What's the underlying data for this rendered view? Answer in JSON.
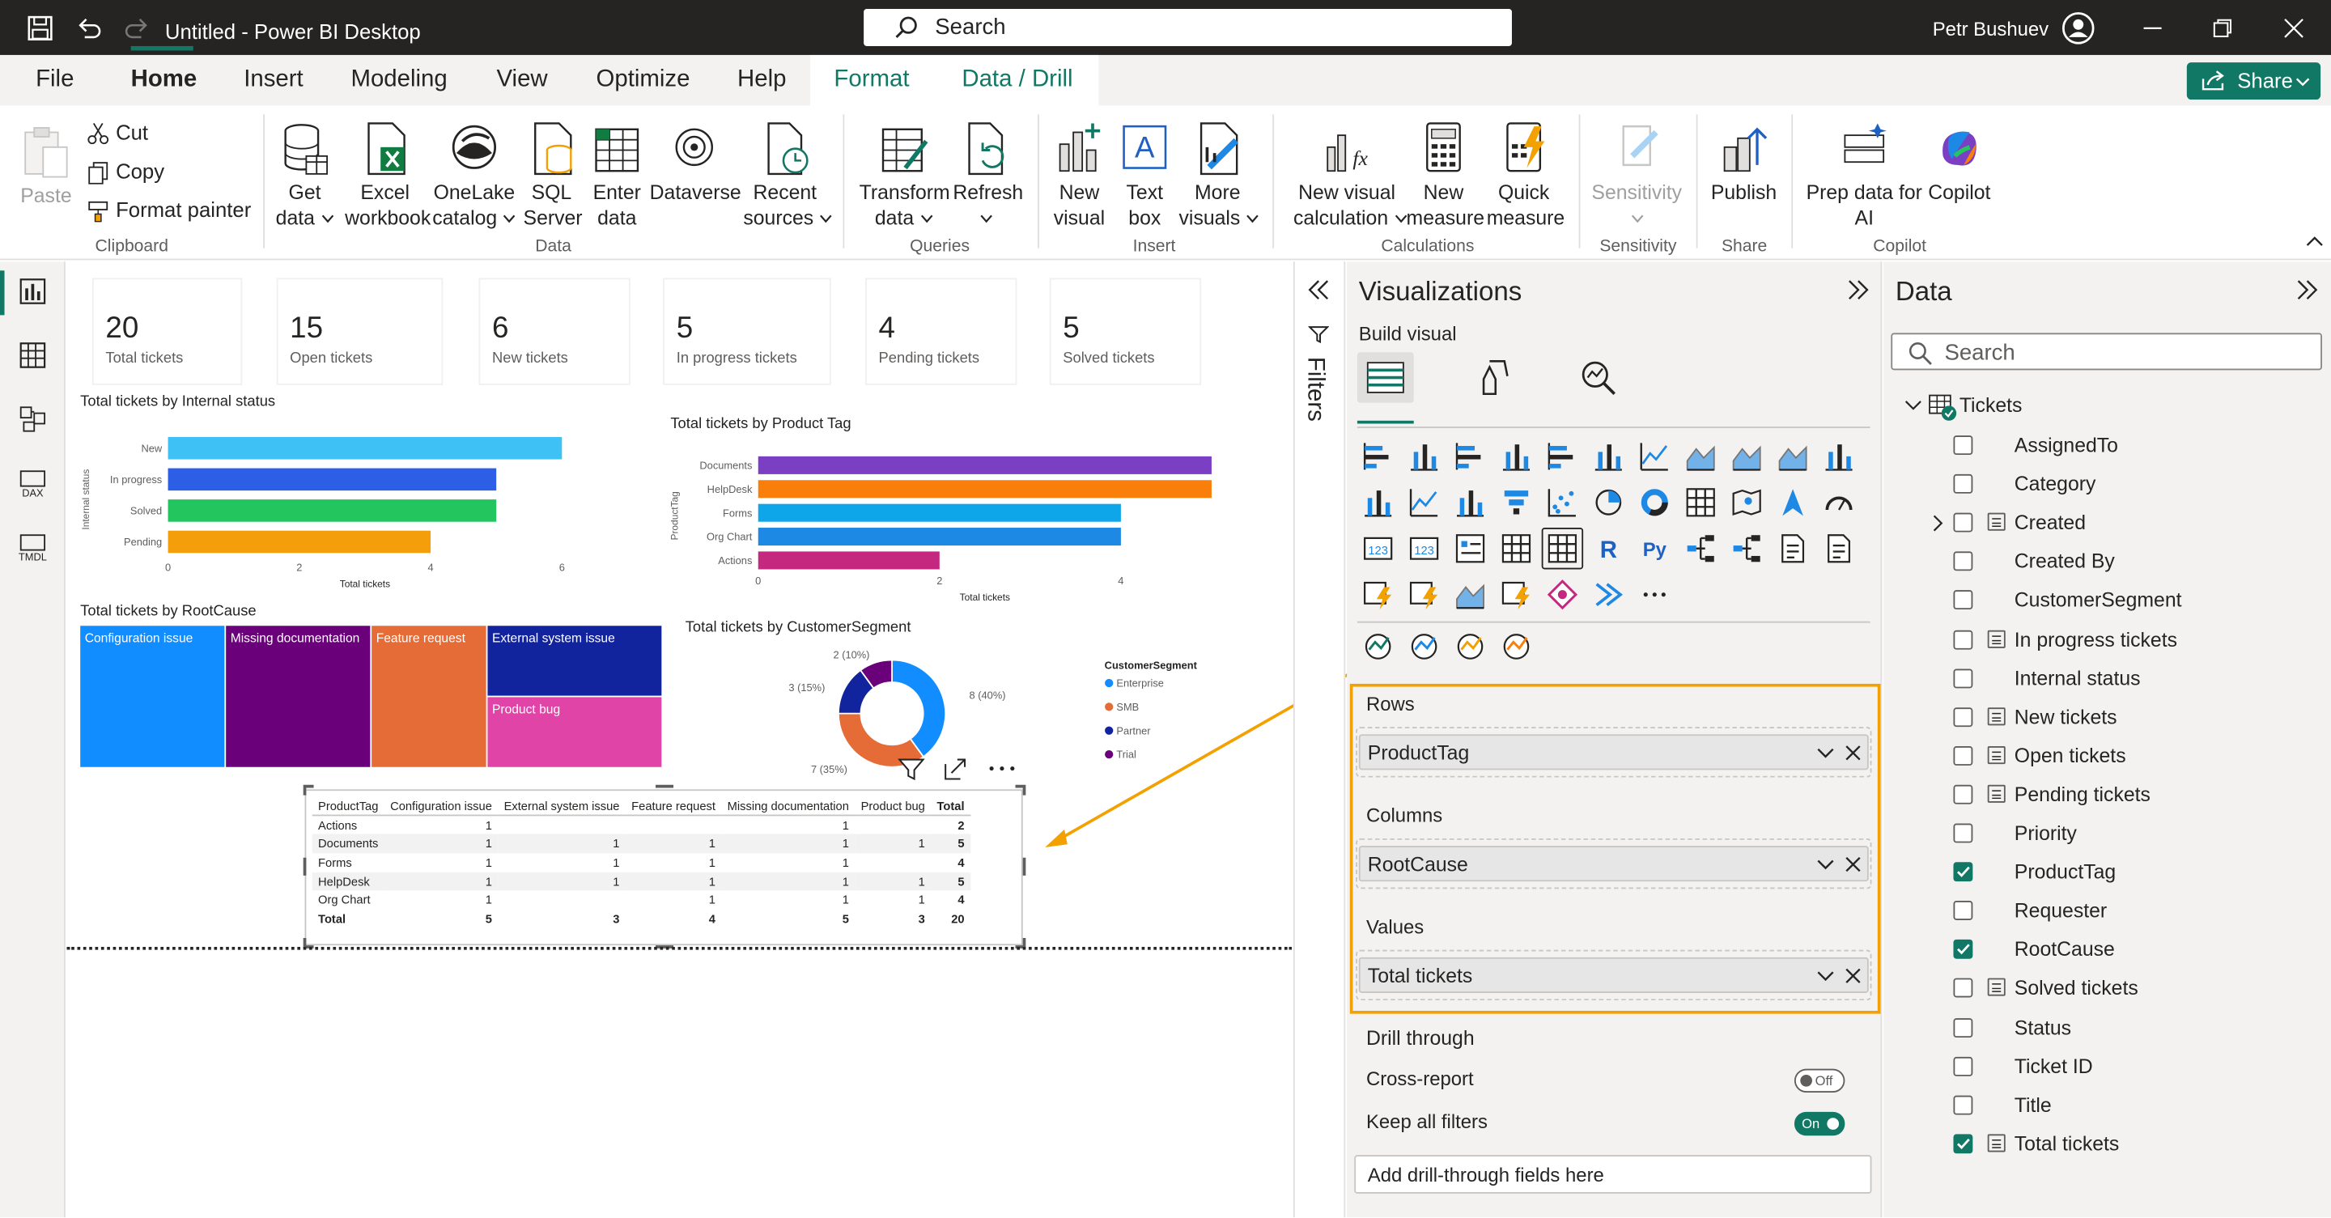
{
  "window": {
    "title": "Untitled - Power BI Desktop",
    "search": "Search",
    "user": "Petr Bushuev"
  },
  "menu": {
    "items": [
      "File",
      "Home",
      "Insert",
      "Modeling",
      "View",
      "Optimize",
      "Help",
      "Format",
      "Data / Drill"
    ],
    "share": "Share"
  },
  "ribbon": {
    "clipboard": {
      "paste": "Paste",
      "cut": "Cut",
      "copy": "Copy",
      "format_painter": "Format painter",
      "group": "Clipboard"
    },
    "data": {
      "get_data": [
        "Get",
        "data"
      ],
      "excel": [
        "Excel",
        "workbook"
      ],
      "onelake": [
        "OneLake",
        "catalog"
      ],
      "sql": [
        "SQL",
        "Server"
      ],
      "enter": [
        "Enter",
        "data"
      ],
      "dataverse": "Dataverse",
      "recent": [
        "Recent",
        "sources"
      ],
      "group": "Data"
    },
    "queries": {
      "transform": [
        "Transform",
        "data"
      ],
      "refresh": "Refresh",
      "group": "Queries"
    },
    "insert": {
      "new_visual": [
        "New",
        "visual"
      ],
      "text_box": [
        "Text",
        "box"
      ],
      "more": [
        "More",
        "visuals"
      ],
      "group": "Insert"
    },
    "calculations": {
      "new_visual_calc": [
        "New visual",
        "calculation"
      ],
      "new_measure": [
        "New",
        "measure"
      ],
      "quick_measure": [
        "Quick",
        "measure"
      ],
      "group": "Calculations"
    },
    "sensitivity": {
      "label": "Sensitivity",
      "group": "Sensitivity"
    },
    "share": {
      "publish": "Publish",
      "group": "Share"
    },
    "copilot": {
      "prep": [
        "Prep data for",
        "AI"
      ],
      "copilot": "Copilot",
      "group": "Copilot"
    }
  },
  "left_nav": {
    "items": [
      "report-view",
      "table-view",
      "model-view",
      "DAX",
      "TMDL"
    ]
  },
  "cards": [
    {
      "value": "20",
      "label": "Total tickets"
    },
    {
      "value": "15",
      "label": "Open tickets"
    },
    {
      "value": "6",
      "label": "New tickets"
    },
    {
      "value": "5",
      "label": "In progress tickets"
    },
    {
      "value": "4",
      "label": "Pending tickets"
    },
    {
      "value": "5",
      "label": "Solved tickets"
    }
  ],
  "chart_data": [
    {
      "type": "bar",
      "title": "Total tickets by Internal status",
      "categories": [
        "New",
        "In progress",
        "Solved",
        "Pending"
      ],
      "values": [
        6,
        5,
        5,
        4
      ],
      "colors": [
        "#3ec2f5",
        "#2d5ee6",
        "#22c55e",
        "#f59e0b"
      ],
      "xlabel": "Total tickets",
      "ylabel": "Internal status",
      "xlim": [
        0,
        6
      ],
      "xticks": [
        "0",
        "2",
        "4",
        "6"
      ]
    },
    {
      "type": "bar",
      "title": "Total tickets by Product Tag",
      "categories": [
        "Documents",
        "HelpDesk",
        "Forms",
        "Org Chart",
        "Actions"
      ],
      "values": [
        5,
        5,
        4,
        4,
        2
      ],
      "colors": [
        "#7b3fc4",
        "#f97f0a",
        "#0ea5e9",
        "#1e88e5",
        "#c4287f"
      ],
      "xlabel": "Total tickets",
      "ylabel": "ProductTag",
      "xlim": [
        0,
        5
      ],
      "xticks": [
        "0",
        "2",
        "4"
      ]
    },
    {
      "type": "heatmap",
      "title": "Total tickets by RootCause",
      "categories": [
        "Configuration issue",
        "Missing documentation",
        "Feature request",
        "External system issue",
        "Product bug"
      ],
      "values": [
        5,
        5,
        4,
        3,
        3
      ],
      "colors": [
        "#118dff",
        "#6b007b",
        "#e66c37",
        "#12239e",
        "#e044a7"
      ]
    },
    {
      "type": "pie",
      "title": "Total tickets by CustomerSegment",
      "legend_title": "CustomerSegment",
      "categories": [
        "Enterprise",
        "SMB",
        "Partner",
        "Trial"
      ],
      "values": [
        8,
        7,
        3,
        2
      ],
      "labels": [
        "8 (40%)",
        "7 (35%)",
        "3 (15%)",
        "2 (10%)"
      ],
      "colors": [
        "#118dff",
        "#e66c37",
        "#12239e",
        "#6b007b"
      ]
    }
  ],
  "matrix": {
    "headers": [
      "ProductTag",
      "Configuration issue",
      "External system issue",
      "Feature request",
      "Missing documentation",
      "Product bug",
      "Total"
    ],
    "rows": [
      [
        "Actions",
        "1",
        "",
        "",
        "1",
        "",
        "2"
      ],
      [
        "Documents",
        "1",
        "1",
        "1",
        "1",
        "1",
        "5"
      ],
      [
        "Forms",
        "1",
        "1",
        "1",
        "1",
        "",
        "4"
      ],
      [
        "HelpDesk",
        "1",
        "1",
        "1",
        "1",
        "1",
        "5"
      ],
      [
        "Org Chart",
        "1",
        "",
        "1",
        "1",
        "1",
        "4"
      ],
      [
        "Total",
        "5",
        "3",
        "4",
        "5",
        "3",
        "20"
      ]
    ]
  },
  "filters": {
    "label": "Filters"
  },
  "visualizations": {
    "title": "Visualizations",
    "build": "Build visual",
    "wells": {
      "rows": "Rows",
      "rows_field": "ProductTag",
      "columns": "Columns",
      "columns_field": "RootCause",
      "values": "Values",
      "values_field": "Total tickets"
    },
    "drill": {
      "title": "Drill through",
      "cross_report": "Cross-report",
      "cross_state": "Off",
      "keep": "Keep all filters",
      "keep_state": "On",
      "add": "Add drill-through fields here"
    },
    "r_label": "R",
    "py_label": "Py"
  },
  "data_pane": {
    "title": "Data",
    "search": "Search",
    "table": "Tickets",
    "fields": [
      {
        "name": "AssignedTo",
        "checked": false,
        "calc": false
      },
      {
        "name": "Category",
        "checked": false,
        "calc": false
      },
      {
        "name": "Created",
        "checked": false,
        "calc": true,
        "expand": true
      },
      {
        "name": "Created By",
        "checked": false,
        "calc": false
      },
      {
        "name": "CustomerSegment",
        "checked": false,
        "calc": false
      },
      {
        "name": "In progress tickets",
        "checked": false,
        "calc": true
      },
      {
        "name": "Internal status",
        "checked": false,
        "calc": false
      },
      {
        "name": "New tickets",
        "checked": false,
        "calc": true
      },
      {
        "name": "Open tickets",
        "checked": false,
        "calc": true
      },
      {
        "name": "Pending tickets",
        "checked": false,
        "calc": true
      },
      {
        "name": "Priority",
        "checked": false,
        "calc": false
      },
      {
        "name": "ProductTag",
        "checked": true,
        "calc": false
      },
      {
        "name": "Requester",
        "checked": false,
        "calc": false
      },
      {
        "name": "RootCause",
        "checked": true,
        "calc": false
      },
      {
        "name": "Solved tickets",
        "checked": false,
        "calc": true
      },
      {
        "name": "Status",
        "checked": false,
        "calc": false
      },
      {
        "name": "Ticket ID",
        "checked": false,
        "calc": false
      },
      {
        "name": "Title",
        "checked": false,
        "calc": false
      },
      {
        "name": "Total tickets",
        "checked": true,
        "calc": true
      }
    ]
  },
  "colors": {
    "accent": "#117865",
    "highlight": "#f2a100"
  }
}
